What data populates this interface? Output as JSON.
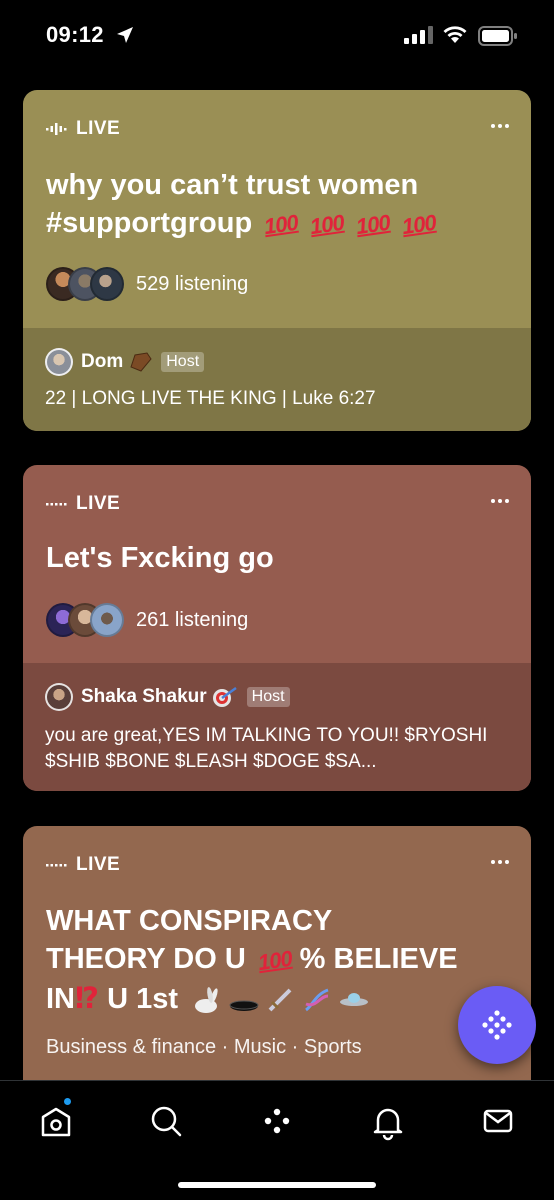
{
  "status_bar": {
    "time": "09:12"
  },
  "cards": [
    {
      "live_label": "LIVE",
      "title": "why you can’t trust women #supportgroup",
      "listeners": "529 listening",
      "host_name": "Dom",
      "host_badge": "Host",
      "description": "22 | LONG LIVE THE KING | Luke 6:27",
      "color_top": "#9a8f55",
      "color_bottom": "#7f7646"
    },
    {
      "live_label": "LIVE",
      "title": "Let's Fxcking go",
      "listeners": "261 listening",
      "host_name": "Shaka Shakur",
      "host_badge": "Host",
      "description": "you are great,YES IM TALKING TO YOU!! $RYOSHI $SHIB $BONE $LEASH  $DOGE $SA...",
      "color_top": "#955c4f",
      "color_bottom": "#7b4a40"
    },
    {
      "live_label": "LIVE",
      "title_line1": "WHAT CONSPIRACY",
      "title_line2a": "THEORY DO U",
      "title_line2b": "% BELIEVE",
      "title_line3a": "IN",
      "title_line3b": "U 1st",
      "topics": "Business & finance · Music · Sports",
      "color_top": "#93684f"
    }
  ],
  "emoji": {
    "hundred": "100",
    "interrobang": "⁉",
    "coffin": "⚰",
    "dart": "🎯",
    "rabbit": "🐇",
    "hole": "🕳",
    "sword": "🗡",
    "dna": "🧬",
    "ufo": "🛸"
  },
  "tabs": [
    "home-icon",
    "search-icon",
    "spaces-icon",
    "notifications-icon",
    "messages-icon"
  ]
}
